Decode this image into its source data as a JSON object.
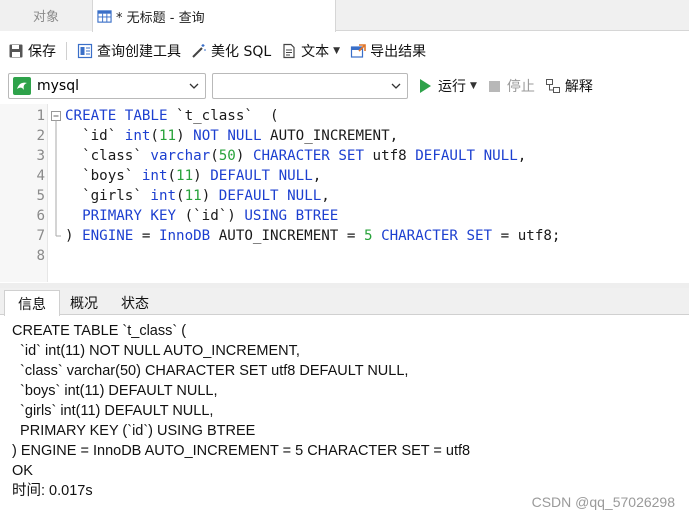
{
  "tabs": {
    "objects": "对象",
    "query": "* 无标题 - 查询"
  },
  "toolbar": {
    "save": "保存",
    "query_builder": "查询创建工具",
    "beautify_sql": "美化 SQL",
    "text": "文本",
    "export_results": "导出结果"
  },
  "selectors": {
    "connection": "mysql",
    "database": "",
    "run": "运行",
    "stop": "停止",
    "explain": "解释"
  },
  "editor": {
    "lines": [
      {
        "n": "1",
        "tokens": [
          [
            "kw",
            "CREATE TABLE "
          ],
          [
            "txt",
            "`t_class`  ("
          ]
        ]
      },
      {
        "n": "2",
        "tokens": [
          [
            "txt",
            "  `id` "
          ],
          [
            "kw",
            "int"
          ],
          [
            "txt",
            "("
          ],
          [
            "num",
            "11"
          ],
          [
            "txt",
            ") "
          ],
          [
            "kw",
            "NOT NULL"
          ],
          [
            "txt",
            " AUTO_INCREMENT,"
          ]
        ]
      },
      {
        "n": "3",
        "tokens": [
          [
            "txt",
            "  `class` "
          ],
          [
            "kw",
            "varchar"
          ],
          [
            "txt",
            "("
          ],
          [
            "num",
            "50"
          ],
          [
            "txt",
            ") "
          ],
          [
            "kw",
            "CHARACTER SET"
          ],
          [
            "txt",
            " utf8 "
          ],
          [
            "kw",
            "DEFAULT NULL"
          ],
          [
            "txt",
            ","
          ]
        ]
      },
      {
        "n": "4",
        "tokens": [
          [
            "txt",
            "  `boys` "
          ],
          [
            "kw",
            "int"
          ],
          [
            "txt",
            "("
          ],
          [
            "num",
            "11"
          ],
          [
            "txt",
            ") "
          ],
          [
            "kw",
            "DEFAULT NULL"
          ],
          [
            "txt",
            ","
          ]
        ]
      },
      {
        "n": "5",
        "tokens": [
          [
            "txt",
            "  `girls` "
          ],
          [
            "kw",
            "int"
          ],
          [
            "txt",
            "("
          ],
          [
            "num",
            "11"
          ],
          [
            "txt",
            ") "
          ],
          [
            "kw",
            "DEFAULT NULL"
          ],
          [
            "txt",
            ","
          ]
        ]
      },
      {
        "n": "6",
        "tokens": [
          [
            "kw",
            "  PRIMARY KEY "
          ],
          [
            "txt",
            "(`id`) "
          ],
          [
            "kw",
            "USING BTREE"
          ]
        ]
      },
      {
        "n": "7",
        "tokens": [
          [
            "txt",
            ") "
          ],
          [
            "kw",
            "ENGINE"
          ],
          [
            "txt",
            " = "
          ],
          [
            "kw",
            "InnoDB"
          ],
          [
            "txt",
            " AUTO_INCREMENT = "
          ],
          [
            "num",
            "5"
          ],
          [
            "txt",
            " "
          ],
          [
            "kw",
            "CHARACTER SET"
          ],
          [
            "txt",
            " = utf8;"
          ]
        ]
      },
      {
        "n": "8",
        "tokens": []
      }
    ]
  },
  "bottom_tabs": {
    "info": "信息",
    "overview": "概况",
    "status": "状态"
  },
  "output": {
    "lines": [
      "CREATE TABLE `t_class` (",
      "  `id` int(11) NOT NULL AUTO_INCREMENT,",
      "  `class` varchar(50) CHARACTER SET utf8 DEFAULT NULL,",
      "  `boys` int(11) DEFAULT NULL,",
      "  `girls` int(11) DEFAULT NULL,",
      "  PRIMARY KEY (`id`) USING BTREE",
      ") ENGINE = InnoDB AUTO_INCREMENT = 5 CHARACTER SET = utf8",
      "OK",
      "时间: 0.017s"
    ]
  },
  "watermark": "CSDN @qq_57026298",
  "colors": {
    "keyword": "#1c3fd0",
    "number": "#27a23a",
    "run_green": "#2ea24a"
  }
}
